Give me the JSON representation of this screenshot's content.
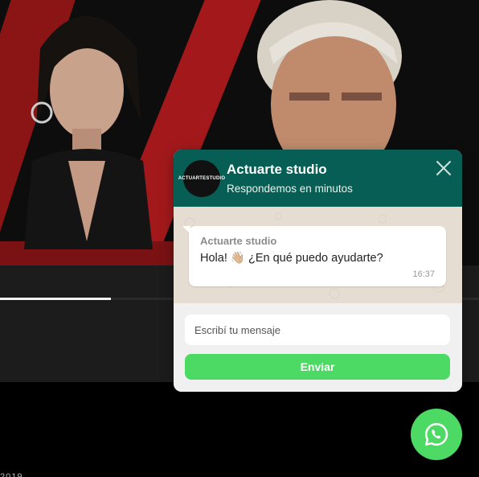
{
  "chat": {
    "avatar_text": "ACTUARTESTUDIO",
    "title": "Actuarte studio",
    "subtitle": "Respondemos en minutos",
    "message": {
      "sender": "Actuarte studio",
      "text": "Hola! 👋🏼 ¿En qué puedo ayudarte?",
      "time": "16:37"
    },
    "input_placeholder": "Escribí tu mensaje",
    "send_label": "Enviar"
  },
  "page": {
    "bottom_fragment": "2019"
  },
  "colors": {
    "header": "#075e54",
    "accent_green": "#4cd964",
    "brand_red": "#a3191b"
  }
}
